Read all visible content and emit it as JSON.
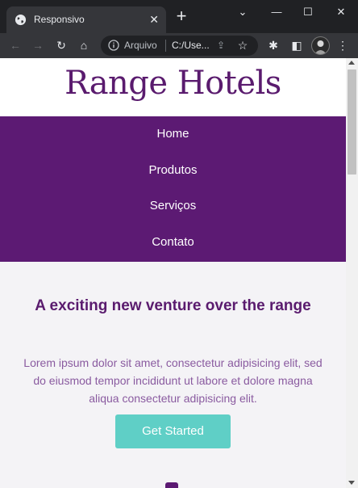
{
  "browser": {
    "tab_title": "Responsivo",
    "tab_close": "✕",
    "new_tab": "+",
    "window_controls": {
      "dropdown": "⌄",
      "minimize": "—",
      "maximize": "☐",
      "close": "✕"
    },
    "omnibox": {
      "scheme_label": "Arquivo",
      "url": "C:/Use..."
    },
    "icons": {
      "back": "←",
      "forward": "→",
      "reload": "↻",
      "home": "⌂",
      "share": "⇪",
      "bookmark": "☆",
      "extensions": "✱",
      "side_panel": "◧",
      "menu": "⋮"
    }
  },
  "site": {
    "logo": "Range Hotels",
    "nav": [
      "Home",
      "Produtos",
      "Serviços",
      "Contato"
    ],
    "hero": {
      "title": "A exciting new venture over the range",
      "text": "Lorem ipsum dolor sit amet, consectetur adipisicing elit, sed do eiusmod tempor incididunt ut labore et dolore magna aliqua consectetur adipisicing elit.",
      "cta": "Get Started"
    },
    "colors": {
      "brand_purple": "#5c1a73",
      "accent_teal": "#5fcfc6",
      "text_purple": "#8a5ba0"
    }
  }
}
